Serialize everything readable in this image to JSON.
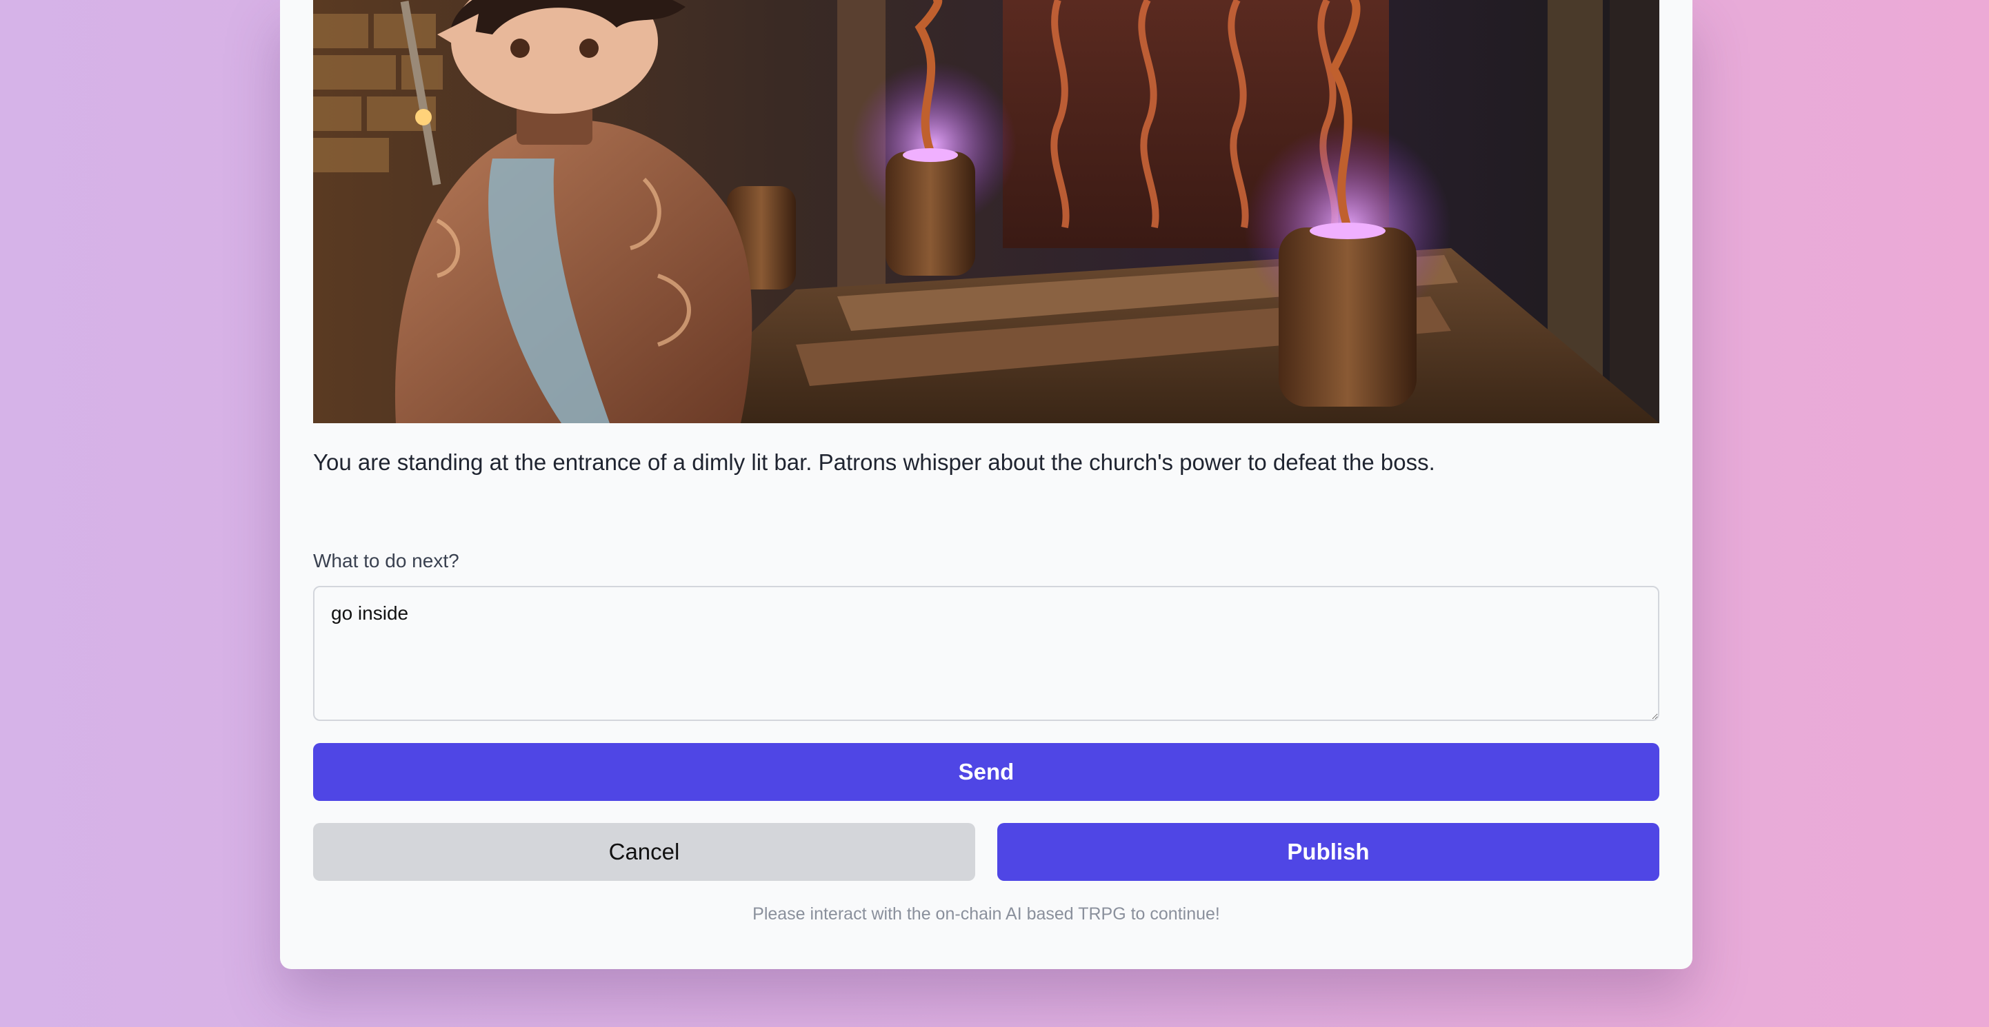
{
  "scene": {
    "image_name": "elf-adventurer-at-bar-entrance"
  },
  "story": {
    "text": "You are standing at the entrance of a dimly lit bar. Patrons whisper about the church's power to defeat the boss."
  },
  "action": {
    "label": "What to do next?",
    "value": "go inside"
  },
  "buttons": {
    "send": "Send",
    "cancel": "Cancel",
    "publish": "Publish"
  },
  "footer": {
    "note": "Please interact with the on-chain AI based TRPG to continue!"
  },
  "colors": {
    "primary": "#4f46e5",
    "secondary": "#d4d6da",
    "card_bg": "#f9fafb"
  }
}
